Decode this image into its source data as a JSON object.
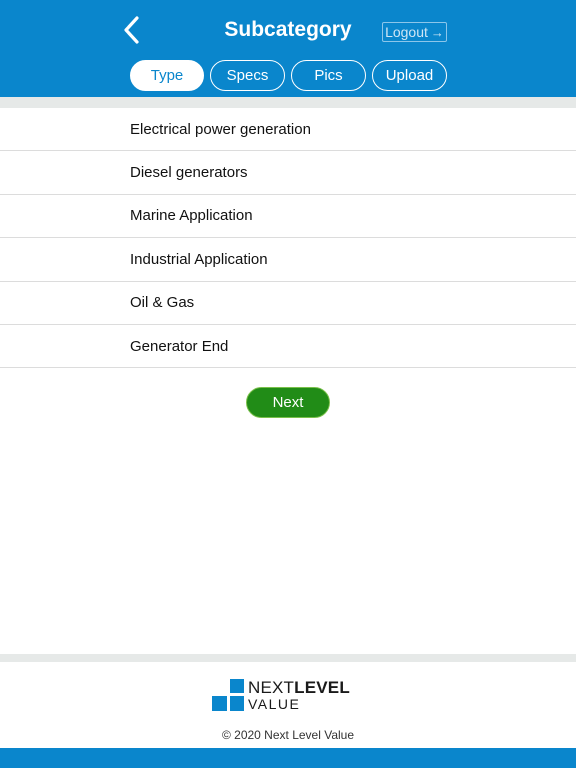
{
  "header": {
    "title": "Subcategory",
    "logout_label": "Logout",
    "logout_arrow": "→",
    "bg_color": "#0a86cc"
  },
  "tabs": [
    {
      "label": "Type",
      "active": true
    },
    {
      "label": "Specs",
      "active": false
    },
    {
      "label": "Pics",
      "active": false
    },
    {
      "label": "Upload",
      "active": false
    }
  ],
  "list": {
    "items": [
      "Electrical power generation",
      "Diesel generators",
      "Marine Application",
      "Industrial Application",
      "Oil & Gas",
      "Generator End"
    ]
  },
  "actions": {
    "next_label": "Next",
    "next_color": "#218c17"
  },
  "footer": {
    "logo_next": "NEXT",
    "logo_level": "LEVEL",
    "logo_value": "VALUE",
    "copyright_symbol": "©",
    "copyright_text": "2020  Next Level Value"
  }
}
